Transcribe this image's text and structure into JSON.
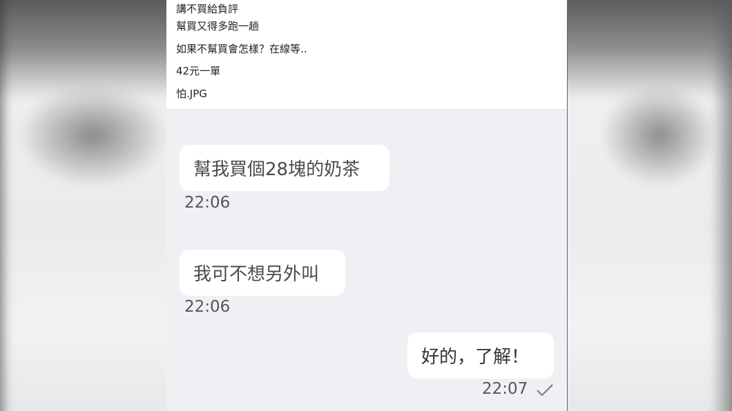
{
  "caption": {
    "lines": [
      "講不買給負評",
      "幫買又得多跑一趟",
      "如果不幫買會怎樣？在線等..",
      "42元一單",
      "怕.JPG"
    ]
  },
  "chat": {
    "messages": [
      {
        "direction": "incoming",
        "text": "幫我買個28塊的奶茶",
        "time": "22:06"
      },
      {
        "direction": "incoming",
        "text": "我可不想另外叫",
        "time": "22:06"
      },
      {
        "direction": "outgoing",
        "text": "好的，了解！",
        "time": "22:07",
        "status_icon": "check-icon"
      }
    ]
  },
  "colors": {
    "chat_background": "#f0eff4",
    "bubble": "#ffffff",
    "edge_accent": "#c01ec8"
  }
}
